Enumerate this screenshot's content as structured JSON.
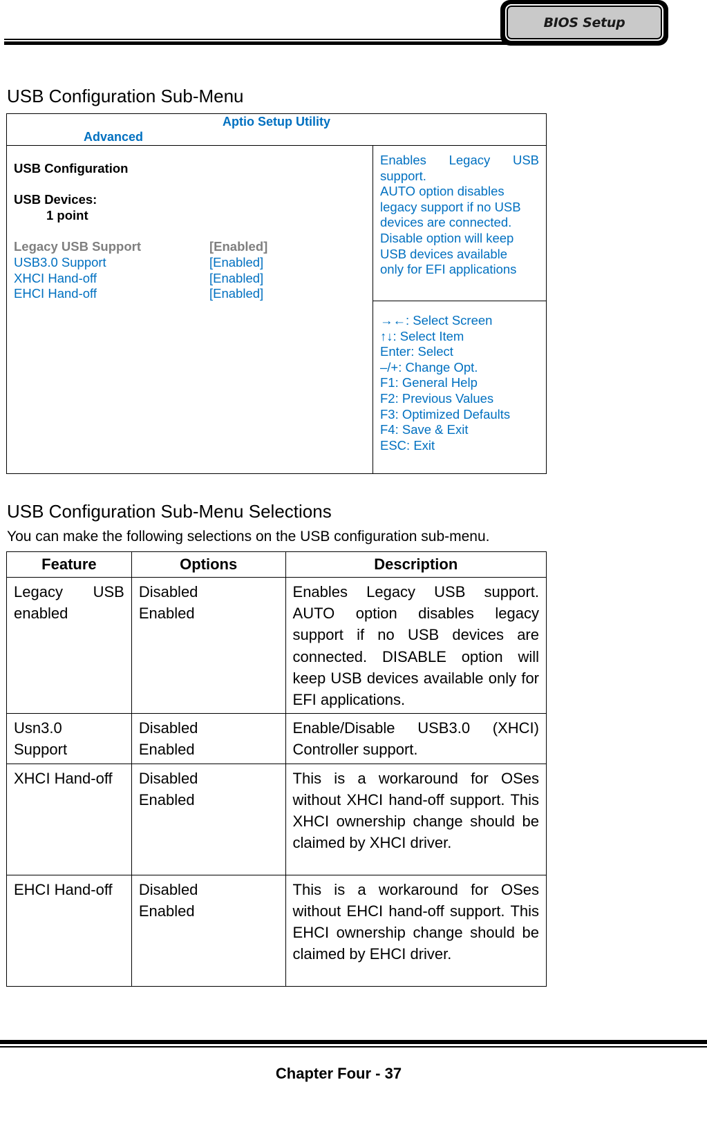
{
  "header": {
    "tab_label": "BIOS Setup"
  },
  "section1": {
    "title": "USB Configuration Sub-Menu"
  },
  "bios": {
    "title": "Aptio Setup Utility",
    "active_tab": "Advanced",
    "heading": "USB Configuration",
    "devices_label": "USB Devices:",
    "devices_value": "1 point",
    "items": [
      {
        "label": "Legacy USB Support",
        "value": "[Enabled]",
        "state": "selected"
      },
      {
        "label": "USB3.0 Support",
        "value": "[Enabled]",
        "state": "normal"
      },
      {
        "label": "XHCI Hand-off",
        "value": "[Enabled]",
        "state": "normal"
      },
      {
        "label": "EHCI Hand-off",
        "value": "[Enabled]",
        "state": "normal"
      }
    ],
    "help": {
      "first_line_words": [
        "Enables",
        "Legacy",
        "USB"
      ],
      "lines": [
        "support.",
        "AUTO option disables",
        "legacy support if no USB",
        "devices are connected.",
        "Disable option will keep",
        "USB devices available",
        "only for EFI applications"
      ]
    },
    "keys": [
      "→←: Select Screen",
      "↑↓: Select Item",
      "Enter: Select",
      "–/+: Change Opt.",
      "F1: General Help",
      "F2: Previous Values",
      "F3: Optimized Defaults",
      "F4: Save & Exit",
      "ESC: Exit"
    ],
    "colors": {
      "accent": "#0070c0",
      "selected": "#7f7f7f"
    }
  },
  "section2": {
    "title": "USB Configuration Sub-Menu Selections",
    "intro": "You can make the following selections on the USB configuration sub-menu."
  },
  "table": {
    "headers": [
      "Feature",
      "Options",
      "Description"
    ],
    "rows": [
      {
        "feature": "Legacy USB enabled",
        "options": [
          "Disabled",
          "Enabled"
        ],
        "description": "Enables Legacy USB support. AUTO option disables legacy support if no USB devices are connected. DISABLE option will keep USB devices available only for EFI applications."
      },
      {
        "feature": "Usn3.0 Support",
        "options": [
          "Disabled",
          "Enabled"
        ],
        "description": "Enable/Disable USB3.0 (XHCI) Controller support."
      },
      {
        "feature": "XHCI Hand-off",
        "options": [
          "Disabled",
          "Enabled"
        ],
        "description": "This is a workaround for OSes without XHCI hand-off support. This XHCI ownership change should be claimed by XHCI driver."
      },
      {
        "feature": "EHCI Hand-off",
        "options": [
          "Disabled",
          "Enabled"
        ],
        "description": "This is a workaround for OSes without EHCI hand-off support. This EHCI ownership change should be claimed by EHCI driver."
      }
    ]
  },
  "footer": {
    "page_label": "Chapter Four - 37"
  }
}
